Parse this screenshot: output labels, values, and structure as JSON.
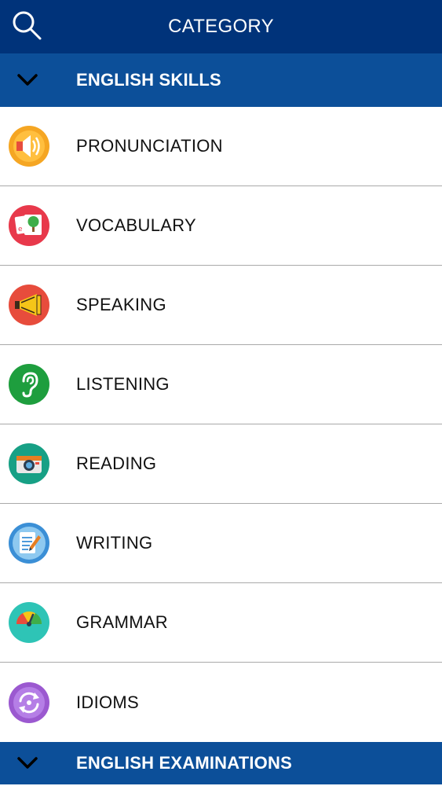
{
  "header": {
    "title": "CATEGORY",
    "search_icon": "search-icon"
  },
  "sections": [
    {
      "label": "ENGLISH SKILLS",
      "expanded": true
    },
    {
      "label": "ENGLISH EXAMINATIONS",
      "expanded": false
    }
  ],
  "items": [
    {
      "label": "PRONUNCIATION",
      "icon": "speaker-icon",
      "color": "#f5a623"
    },
    {
      "label": "VOCABULARY",
      "icon": "flashcards-icon",
      "color": "#e8394b"
    },
    {
      "label": "SPEAKING",
      "icon": "megaphone-icon",
      "color": "#e74c3c"
    },
    {
      "label": "LISTENING",
      "icon": "ear-icon",
      "color": "#1e9e3e"
    },
    {
      "label": "READING",
      "icon": "camera-icon",
      "color": "#17a085"
    },
    {
      "label": "WRITING",
      "icon": "notepad-pencil-icon",
      "color": "#3b8fd6"
    },
    {
      "label": "GRAMMAR",
      "icon": "gauge-icon",
      "color": "#2ec4b6"
    },
    {
      "label": "IDIOMS",
      "icon": "refresh-icon",
      "color": "#9b59d0"
    }
  ],
  "colors": {
    "topbar": "#00337a",
    "section": "#0c4f99"
  }
}
